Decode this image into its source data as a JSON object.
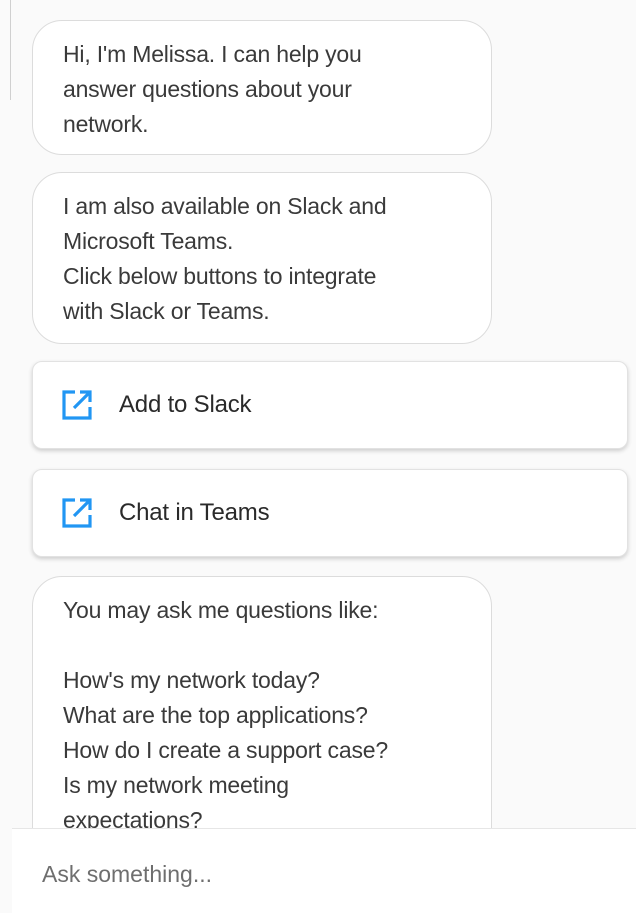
{
  "messages": [
    "Hi, I'm Melissa. I can help you\nanswer questions about your\nnetwork.",
    "I am also available on Slack and\nMicrosoft Teams.\nClick below buttons to integrate\nwith Slack or Teams.",
    "You may ask me questions like:\n\nHow's my network today?\nWhat are the top applications?\nHow do I create a support case?\nIs my network meeting\nexpectations?"
  ],
  "actions": [
    {
      "label": "Add to Slack",
      "icon": "external-link-icon"
    },
    {
      "label": "Chat in Teams",
      "icon": "external-link-icon"
    }
  ],
  "composer": {
    "placeholder": "Ask something..."
  },
  "colors": {
    "icon": "#2196f3",
    "bubble_border": "#dcdcdc",
    "background": "#fafafa"
  }
}
